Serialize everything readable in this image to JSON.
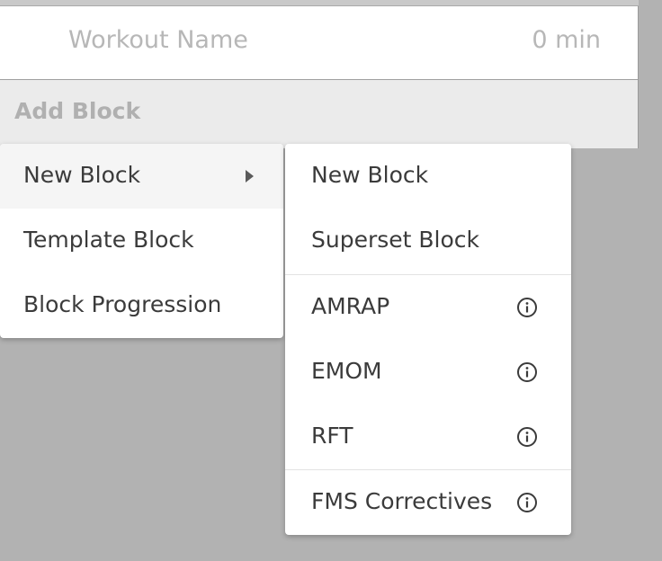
{
  "workout": {
    "name_placeholder": "Workout Name",
    "duration": "0 min"
  },
  "add_block": {
    "label": "Add Block"
  },
  "main_menu": {
    "items": [
      {
        "label": "New Block",
        "has_submenu": true,
        "active": true
      },
      {
        "label": "Template Block"
      },
      {
        "label": "Block Progression"
      }
    ]
  },
  "sub_menu": {
    "items": [
      {
        "label": "New Block"
      },
      {
        "label": "Superset Block"
      },
      {
        "label": "AMRAP",
        "icon": "info-icon"
      },
      {
        "label": "EMOM",
        "icon": "info-icon"
      },
      {
        "label": "RFT",
        "icon": "info-icon"
      },
      {
        "label": "FMS Correctives",
        "icon": "info-icon"
      }
    ]
  },
  "colors": {
    "backdrop": "#b2b2b2",
    "menu_bg": "#ffffff",
    "text": "#3b3b3b",
    "placeholder": "#b7b7b7",
    "add_block_bg": "#ebebeb"
  }
}
